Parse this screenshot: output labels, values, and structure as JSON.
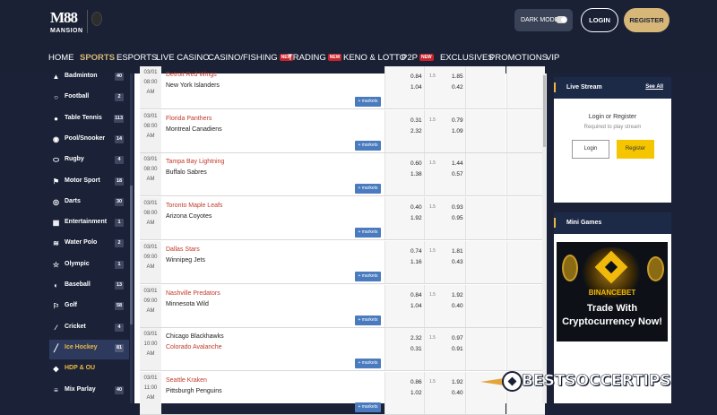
{
  "brand": {
    "logo_top": "M88",
    "logo_bottom": "MANSION"
  },
  "header": {
    "dark_mode_label": "DARK MODE",
    "login_label": "LOGIN",
    "register_label": "REGISTER"
  },
  "nav": [
    {
      "label": "HOME"
    },
    {
      "label": "SPORTS"
    },
    {
      "label": "ESPORTS"
    },
    {
      "label": "LIVE CASINO"
    },
    {
      "label": "CASINO/FISHING",
      "badge": "NEW"
    },
    {
      "label": "TRADING",
      "badge": "NEW"
    },
    {
      "label": "KENO & LOTTO"
    },
    {
      "label": "P2P",
      "badge": "NEW"
    },
    {
      "label": "EXCLUSIVES"
    },
    {
      "label": "PROMOTIONS"
    },
    {
      "label": "VIP"
    }
  ],
  "sidebar": [
    {
      "label": "Badminton",
      "count": "40",
      "icon": "shuttlecock-icon"
    },
    {
      "label": "Football",
      "count": "2",
      "icon": "football-icon"
    },
    {
      "label": "Table Tennis",
      "count": "113",
      "icon": "table-tennis-icon"
    },
    {
      "label": "Pool/Snooker",
      "count": "14",
      "icon": "billiards-icon"
    },
    {
      "label": "Rugby",
      "count": "4",
      "icon": "rugby-icon"
    },
    {
      "label": "Motor Sport",
      "count": "18",
      "icon": "motor-sport-icon"
    },
    {
      "label": "Darts",
      "count": "30",
      "icon": "darts-icon"
    },
    {
      "label": "Entertainment",
      "count": "1",
      "icon": "entertainment-icon"
    },
    {
      "label": "Water Polo",
      "count": "2",
      "icon": "water-polo-icon"
    },
    {
      "label": "Olympic",
      "count": "1",
      "icon": "olympic-icon"
    },
    {
      "label": "Baseball",
      "count": "13",
      "icon": "baseball-icon"
    },
    {
      "label": "Golf",
      "count": "58",
      "icon": "golf-icon"
    },
    {
      "label": "Cricket",
      "count": "4",
      "icon": "cricket-icon"
    },
    {
      "label": "Ice Hockey",
      "count": "81",
      "icon": "ice-hockey-icon"
    },
    {
      "label": "HDP & OU",
      "count": "",
      "icon": "hdp-icon"
    },
    {
      "label": "Mix Parlay",
      "count": "40",
      "icon": "mix-parlay-icon"
    }
  ],
  "more_markets_label": "+ markets",
  "matches": [
    {
      "date": "03/01",
      "time": "08:00",
      "ampm": "AM",
      "home": "Detroit Red Wings",
      "away": "New York Islanders",
      "red": "home",
      "o1": "0.84",
      "o2": "1.04",
      "h": "1.5",
      "o3": "1.85",
      "o4": "0.42"
    },
    {
      "date": "03/01",
      "time": "08:00",
      "ampm": "AM",
      "home": "Florida Panthers",
      "away": "Montreal Canadiens",
      "red": "home",
      "o1": "0.31",
      "o2": "2.32",
      "h": "1.5",
      "o3": "0.79",
      "o4": "1.09"
    },
    {
      "date": "03/01",
      "time": "08:00",
      "ampm": "AM",
      "home": "Tampa Bay Lightning",
      "away": "Buffalo Sabres",
      "red": "home",
      "o1": "0.60",
      "o2": "1.38",
      "h": "1.5",
      "o3": "1.44",
      "o4": "0.57"
    },
    {
      "date": "03/01",
      "time": "08:00",
      "ampm": "AM",
      "home": "Toronto Maple Leafs",
      "away": "Arizona Coyotes",
      "red": "home",
      "o1": "0.40",
      "o2": "1.92",
      "h": "1.5",
      "o3": "0.93",
      "o4": "0.95"
    },
    {
      "date": "03/01",
      "time": "09:00",
      "ampm": "AM",
      "home": "Dallas Stars",
      "away": "Winnipeg Jets",
      "red": "home",
      "o1": "0.74",
      "o2": "1.16",
      "h": "1.5",
      "o3": "1.81",
      "o4": "0.43"
    },
    {
      "date": "03/01",
      "time": "09:00",
      "ampm": "AM",
      "home": "Nashville Predators",
      "away": "Minnesota Wild",
      "red": "home",
      "o1": "0.84",
      "o2": "1.04",
      "h": "1.5",
      "o3": "1.92",
      "o4": "0.40"
    },
    {
      "date": "03/01",
      "time": "10:00",
      "ampm": "AM",
      "home": "Chicago Blackhawks",
      "away": "Colorado Avalanche",
      "red": "away",
      "o1": "2.32",
      "o2": "0.31",
      "h": "1.5",
      "o3": "0.97",
      "o4": "0.91"
    },
    {
      "date": "03/01",
      "time": "11:00",
      "ampm": "AM",
      "home": "Seattle Kraken",
      "away": "Pittsburgh Penguins",
      "red": "home",
      "o1": "0.86",
      "o2": "1.02",
      "h": "1.5",
      "o3": "1.92",
      "o4": "0.40"
    }
  ],
  "live_stream": {
    "title": "Live Stream",
    "see_all": "See All",
    "prompt": "Login or Register",
    "sub": "Required to play stream",
    "login": "Login",
    "register": "Register"
  },
  "mini_games": {
    "title": "Mini Games",
    "brand": "BINANCEBET",
    "line1": "Trade With",
    "line2": "Cryptocurrency Now!"
  },
  "watermark": {
    "text": "BESTSOCCERTIPS"
  }
}
